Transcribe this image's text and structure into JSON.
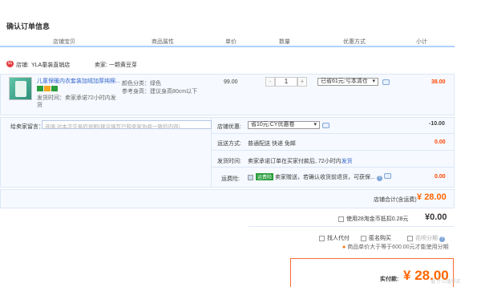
{
  "page_title": "确认订单信息",
  "columns": [
    "店铺宝贝",
    "商品属性",
    "单价",
    "数量",
    "优惠方式",
    "小计"
  ],
  "shop": {
    "icon": "shop-icon",
    "label": "店铺:",
    "name": "YLA童装直销店",
    "seller_label": "卖家:",
    "seller": "一颗黄豆芽"
  },
  "item": {
    "title": "儿童保暖内衣套装加绒加厚纯棉...",
    "ship_note": "发货时间：卖家承诺72小时内发货",
    "color": "颜色分类：绿色",
    "size": "参考身高：建议身高80cm以下",
    "price": "99.00",
    "qty": "1",
    "discount": "已省61元:亏本清仓",
    "subtotal": "38.00"
  },
  "message": {
    "label": "给卖家留言：",
    "placeholder": "选填:对本次交易的说明(建议填写已和卖家协商一致的内容)"
  },
  "coupon": {
    "label": "店铺优惠:",
    "value": "省10元:CY优惠卷",
    "amount": "-10.00"
  },
  "delivery": {
    "label": "运送方式:",
    "value": "普通配送 快递 免邮",
    "amount": "0.00"
  },
  "ship_time": {
    "label": "发货时间:",
    "value": "卖家承诺订单在买家付款后, 72小时内",
    "link": "发货"
  },
  "insurance": {
    "label": "运费险:",
    "tag": "运费险",
    "text": "卖家赠送，若确认收货前退货，可获保...",
    "amount": "0.00"
  },
  "shop_total": {
    "label": "店铺合计(含运费)",
    "symbol": "¥",
    "value": "28.00"
  },
  "tmall_points": {
    "label": "使用28淘金币抵扣0.28元",
    "symbol": "¥",
    "value": "0.00"
  },
  "options": [
    "找人代付",
    "匿名购买",
    "花呗分期"
  ],
  "installment_note": "商品单价大于等于600.00元才能使用分期",
  "pay": {
    "label": "实付款:",
    "symbol": "¥",
    "value": "28.00"
  },
  "watermark": "值 什么值得买"
}
